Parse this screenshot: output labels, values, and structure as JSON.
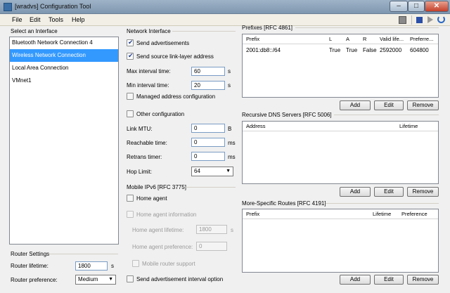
{
  "window": {
    "title": "[wradvs] Configuration Tool",
    "min": "–",
    "max": "□",
    "close": "✕"
  },
  "menu": {
    "file": "File",
    "edit": "Edit",
    "tools": "Tools",
    "help": "Help"
  },
  "left": {
    "select_label": "Select an Interface",
    "interfaces": [
      "Bluetooth Network Connection 4",
      "Wireless Network Connection",
      "Local Area Connection",
      "VMnet1"
    ],
    "router_settings": "Router Settings",
    "router_lifetime_label": "Router lifetime:",
    "router_lifetime": "1800",
    "router_lifetime_unit": "s",
    "router_pref_label": "Router preference:",
    "router_pref": "Medium"
  },
  "ni": {
    "title": "Network Interface",
    "send_adv": "Send advertisements",
    "send_src": "Send source link-layer address",
    "max_int_label": "Max interval time:",
    "max_int": "60",
    "min_int_label": "Min interval time:",
    "min_int": "20",
    "unit_s": "s",
    "managed": "Managed address configuration",
    "other": "Other configuration",
    "mtu_label": "Link MTU:",
    "mtu": "0",
    "mtu_unit": "B",
    "reach_label": "Reachable time:",
    "reach": "0",
    "unit_ms": "ms",
    "retrans_label": "Retrans timer:",
    "retrans": "0",
    "hop_label": "Hop Limit:",
    "hop": "64"
  },
  "mip": {
    "title": "Mobile IPv6 [RFC 3775]",
    "home_agent": "Home agent",
    "ha_info": "Home agent information",
    "ha_life_label": "Home agent lifetime:",
    "ha_life": "1800",
    "ha_life_unit": "s",
    "ha_pref_label": "Home agent preference:",
    "ha_pref": "0",
    "mobile_router": "Mobile router support",
    "send_adv_int": "Send advertisement interval option"
  },
  "prefixes": {
    "title": "Prefixes [RFC 4861]",
    "cols": [
      "Prefix",
      "L",
      "A",
      "R",
      "Valid life...",
      "Preferre..."
    ],
    "rows": [
      [
        "2001:db8::/64",
        "True",
        "True",
        "False",
        "2592000",
        "604800"
      ]
    ]
  },
  "dns": {
    "title": "Recursive DNS Servers [RFC 5006]",
    "cols": [
      "Address",
      "Lifetime"
    ]
  },
  "routes": {
    "title": "More-Specific Routes [RFC 4191]",
    "cols": [
      "Prefix",
      "Lifetime",
      "Preference"
    ]
  },
  "buttons": {
    "add": "Add",
    "edit": "Edit",
    "remove": "Remove"
  },
  "colors": {
    "selection": "#3399ff",
    "window_bg": "#f0f0f0"
  }
}
